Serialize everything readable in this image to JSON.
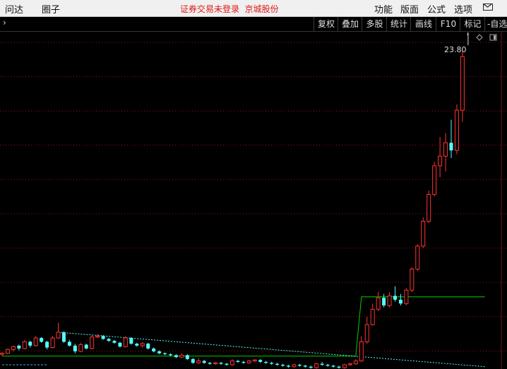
{
  "menubar": {
    "items_left": [
      "问达",
      "圈子"
    ],
    "status": "证券交易未登录",
    "stock_name": "京城股份",
    "items_right": [
      "功能",
      "版面",
      "公式",
      "选项"
    ]
  },
  "toolbar": {
    "buttons": [
      "复权",
      "叠加",
      "多股",
      "统计",
      "画线",
      "F10",
      "标记",
      "-自选"
    ]
  },
  "chart_data": {
    "type": "candlestick",
    "max_price_label": "23.80",
    "price_range": [
      7.4,
      24.8
    ],
    "colors": {
      "up": "#ff3232",
      "down": "#54fcfc",
      "grid": "#8a1a1a",
      "support_line": "#00d000"
    },
    "candles": [
      [
        7.95,
        8.05,
        7.85,
        8.0
      ],
      [
        8.0,
        8.25,
        7.95,
        8.2
      ],
      [
        8.2,
        8.4,
        8.1,
        8.35
      ],
      [
        8.4,
        8.45,
        8.15,
        8.25
      ],
      [
        8.25,
        8.7,
        8.2,
        8.6
      ],
      [
        8.6,
        8.65,
        8.3,
        8.4
      ],
      [
        8.4,
        8.9,
        8.35,
        8.8
      ],
      [
        8.8,
        8.85,
        8.55,
        8.6
      ],
      [
        8.6,
        8.65,
        8.2,
        8.3
      ],
      [
        8.3,
        8.9,
        8.25,
        8.8
      ],
      [
        8.8,
        9.6,
        8.75,
        9.1
      ],
      [
        9.1,
        9.15,
        8.55,
        8.6
      ],
      [
        8.6,
        8.7,
        8.35,
        8.4
      ],
      [
        8.4,
        8.5,
        8.0,
        8.1
      ],
      [
        8.1,
        8.55,
        8.05,
        8.45
      ],
      [
        8.45,
        8.5,
        8.2,
        8.25
      ],
      [
        8.25,
        8.95,
        8.2,
        8.85
      ],
      [
        8.85,
        9.0,
        8.8,
        8.9
      ],
      [
        8.9,
        8.95,
        8.7,
        8.75
      ],
      [
        8.75,
        8.8,
        8.6,
        8.65
      ],
      [
        8.65,
        8.7,
        8.5,
        8.55
      ],
      [
        8.55,
        8.6,
        8.3,
        8.35
      ],
      [
        8.35,
        8.9,
        8.3,
        8.8
      ],
      [
        8.8,
        8.85,
        8.45,
        8.5
      ],
      [
        8.5,
        8.55,
        8.35,
        8.4
      ],
      [
        8.4,
        8.6,
        8.3,
        8.5
      ],
      [
        8.5,
        8.55,
        8.2,
        8.25
      ],
      [
        8.25,
        8.3,
        8.05,
        8.1
      ],
      [
        8.1,
        8.15,
        7.95,
        8.0
      ],
      [
        8.0,
        8.05,
        7.9,
        7.95
      ],
      [
        7.95,
        8.0,
        7.85,
        7.9
      ],
      [
        7.9,
        7.95,
        7.75,
        7.8
      ],
      [
        7.8,
        8.0,
        7.75,
        7.9
      ],
      [
        7.9,
        7.95,
        7.65,
        7.7
      ],
      [
        7.7,
        7.75,
        7.45,
        7.5
      ],
      [
        7.5,
        7.75,
        7.45,
        7.6
      ],
      [
        7.6,
        7.65,
        7.45,
        7.5
      ],
      [
        7.5,
        7.55,
        7.4,
        7.45
      ],
      [
        7.45,
        7.55,
        7.4,
        7.5
      ],
      [
        7.5,
        7.55,
        7.4,
        7.45
      ],
      [
        7.45,
        7.5,
        7.35,
        7.4
      ],
      [
        7.4,
        7.7,
        7.35,
        7.6
      ],
      [
        7.6,
        7.65,
        7.5,
        7.55
      ],
      [
        7.55,
        7.6,
        7.45,
        7.5
      ],
      [
        7.5,
        7.65,
        7.45,
        7.6
      ],
      [
        7.6,
        7.7,
        7.55,
        7.65
      ],
      [
        7.65,
        7.7,
        7.5,
        7.55
      ],
      [
        7.55,
        7.6,
        7.45,
        7.5
      ],
      [
        7.5,
        7.55,
        7.4,
        7.45
      ],
      [
        7.45,
        7.5,
        7.35,
        7.4
      ],
      [
        7.4,
        7.45,
        7.3,
        7.35
      ],
      [
        7.35,
        7.4,
        7.25,
        7.3
      ],
      [
        7.3,
        7.45,
        7.25,
        7.4
      ],
      [
        7.4,
        7.45,
        7.3,
        7.35
      ],
      [
        7.35,
        7.4,
        7.25,
        7.3
      ],
      [
        7.3,
        7.35,
        7.2,
        7.25
      ],
      [
        7.25,
        7.5,
        7.2,
        7.45
      ],
      [
        7.45,
        7.55,
        7.35,
        7.4
      ],
      [
        7.4,
        7.45,
        7.3,
        7.35
      ],
      [
        7.35,
        7.4,
        7.25,
        7.3
      ],
      [
        7.3,
        7.35,
        7.2,
        7.25
      ],
      [
        7.25,
        7.45,
        7.2,
        7.4
      ],
      [
        7.4,
        7.5,
        7.35,
        7.45
      ],
      [
        7.45,
        7.7,
        7.4,
        7.6
      ],
      [
        7.6,
        8.9,
        7.55,
        8.6
      ],
      [
        8.6,
        9.9,
        8.5,
        9.5
      ],
      [
        9.5,
        10.6,
        9.45,
        10.3
      ],
      [
        10.3,
        11.2,
        10.2,
        10.9
      ],
      [
        10.9,
        11.1,
        10.4,
        10.5
      ],
      [
        10.5,
        11.2,
        10.4,
        11.0
      ],
      [
        11.0,
        11.5,
        10.7,
        10.8
      ],
      [
        10.8,
        11.1,
        10.5,
        10.6
      ],
      [
        10.6,
        11.4,
        10.5,
        11.3
      ],
      [
        11.3,
        12.5,
        11.2,
        12.4
      ],
      [
        12.4,
        13.7,
        12.3,
        13.6
      ],
      [
        13.6,
        15.1,
        13.5,
        14.9
      ],
      [
        14.9,
        16.5,
        14.8,
        16.3
      ],
      [
        16.3,
        18.0,
        16.2,
        17.8
      ],
      [
        17.8,
        19.3,
        17.2,
        18.3
      ],
      [
        18.3,
        19.5,
        17.5,
        19.0
      ],
      [
        19.0,
        20.2,
        18.2,
        18.6
      ],
      [
        18.6,
        21.0,
        18.4,
        20.7
      ],
      [
        20.7,
        23.8,
        20.1,
        23.5
      ]
    ],
    "support_line": {
      "from_index": 0,
      "to_index": 63,
      "price": 7.85,
      "jump_index": 64,
      "price_after": 10.95,
      "end_index": 86
    },
    "trend_line": {
      "from_index": 10,
      "from_price": 9.1,
      "to_index": 86,
      "to_price": 7.3
    },
    "tail_line": {
      "from_index": 0,
      "to_index": 8,
      "price": 7.85
    }
  }
}
